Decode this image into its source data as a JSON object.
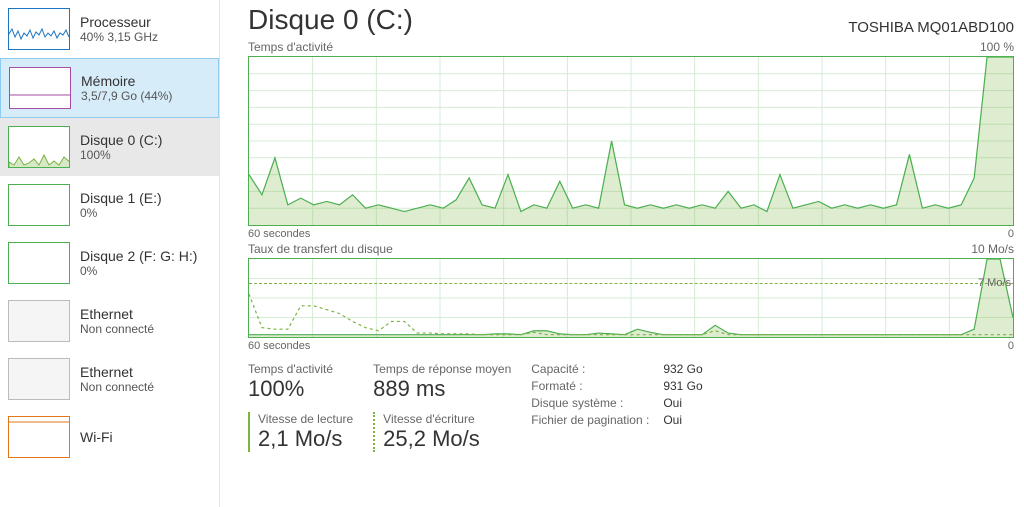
{
  "sidebar": [
    {
      "title": "Processeur",
      "sub": "40%  3,15 GHz",
      "kind": "blue"
    },
    {
      "title": "Mémoire",
      "sub": "3,5/7,9 Go (44%)",
      "kind": "purple",
      "state": "mem"
    },
    {
      "title": "Disque 0 (C:)",
      "sub": "100%",
      "kind": "green",
      "state": "dsk"
    },
    {
      "title": "Disque 1 (E:)",
      "sub": "0%",
      "kind": "green"
    },
    {
      "title": "Disque 2 (F: G: H:)",
      "sub": "0%",
      "kind": "green"
    },
    {
      "title": "Ethernet",
      "sub": "Non connecté",
      "kind": "gray"
    },
    {
      "title": "Ethernet",
      "sub": "Non connecté",
      "kind": "gray"
    },
    {
      "title": "Wi-Fi",
      "sub": "",
      "kind": "orange"
    }
  ],
  "header": {
    "title": "Disque 0 (C:)",
    "model": "TOSHIBA MQ01ABD100"
  },
  "chart_data": [
    {
      "type": "area",
      "title": "Temps d'activité",
      "ylabel": "100 %",
      "xlabel_left": "60 secondes",
      "xlabel_right": "0",
      "ylim": [
        0,
        100
      ],
      "x": [
        0,
        1,
        2,
        3,
        4,
        5,
        6,
        7,
        8,
        9,
        10,
        11,
        12,
        13,
        14,
        15,
        16,
        17,
        18,
        19,
        20,
        21,
        22,
        23,
        24,
        25,
        26,
        27,
        28,
        29,
        30,
        31,
        32,
        33,
        34,
        35,
        36,
        37,
        38,
        39,
        40,
        41,
        42,
        43,
        44,
        45,
        46,
        47,
        48,
        49,
        50,
        51,
        52,
        53,
        54,
        55,
        56,
        57,
        58,
        59
      ],
      "values": [
        30,
        18,
        40,
        12,
        16,
        12,
        14,
        12,
        18,
        10,
        12,
        10,
        8,
        10,
        12,
        10,
        15,
        28,
        12,
        10,
        30,
        8,
        12,
        10,
        26,
        10,
        12,
        10,
        50,
        12,
        10,
        12,
        10,
        12,
        10,
        12,
        10,
        20,
        10,
        12,
        8,
        30,
        10,
        12,
        14,
        10,
        12,
        10,
        12,
        10,
        12,
        42,
        10,
        12,
        10,
        12,
        28,
        100,
        100,
        100
      ]
    },
    {
      "type": "line-area",
      "title": "Taux de transfert du disque",
      "ylabel": "10 Mo/s",
      "xlabel_left": "60 secondes",
      "xlabel_right": "0",
      "ylim": [
        0,
        10
      ],
      "marker": {
        "value": 7,
        "label": "7 Mo/s"
      },
      "series": [
        {
          "name": "read",
          "style": "dashed",
          "values": [
            5.5,
            1.2,
            1.0,
            1.0,
            4.0,
            4.0,
            3.5,
            3.0,
            2.0,
            1.2,
            0.8,
            2.0,
            2.0,
            0.5,
            0.5,
            0.4,
            0.4,
            0.4,
            0.3,
            0.3,
            0.3,
            0.3,
            0.6,
            0.3,
            0.3,
            0.3,
            0.3,
            0.3,
            0.3,
            0.3,
            0.3,
            0.3,
            0.3,
            0.3,
            0.3,
            0.3,
            0.8,
            0.3,
            0.3,
            0.3,
            0.3,
            0.3,
            0.3,
            0.3,
            0.3,
            0.3,
            0.3,
            0.3,
            0.3,
            0.3,
            0.3,
            0.3,
            0.3,
            0.3,
            0.3,
            0.3,
            0.3,
            0.3,
            0.3,
            0.3
          ]
        },
        {
          "name": "write",
          "style": "solid-area",
          "values": [
            0.3,
            0.3,
            0.3,
            0.3,
            0.3,
            0.3,
            0.3,
            0.3,
            0.3,
            0.3,
            0.3,
            0.3,
            0.3,
            0.3,
            0.3,
            0.3,
            0.3,
            0.3,
            0.3,
            0.4,
            0.4,
            0.3,
            0.8,
            0.8,
            0.4,
            0.3,
            0.3,
            0.5,
            0.4,
            0.3,
            1.0,
            0.6,
            0.3,
            0.3,
            0.3,
            0.3,
            1.5,
            0.5,
            0.3,
            0.3,
            0.3,
            0.3,
            0.3,
            0.3,
            0.3,
            0.3,
            0.3,
            0.3,
            0.3,
            0.3,
            0.3,
            0.3,
            0.3,
            0.3,
            0.3,
            0.3,
            1.0,
            10,
            10,
            2.5
          ]
        }
      ]
    }
  ],
  "stats": {
    "activity_label": "Temps d'activité",
    "activity_value": "100%",
    "response_label": "Temps de réponse moyen",
    "response_value": "889 ms",
    "read_label": "Vitesse de lecture",
    "read_value": "2,1 Mo/s",
    "write_label": "Vitesse d'écriture",
    "write_value": "25,2 Mo/s"
  },
  "props": {
    "labels": [
      "Capacité :",
      "Formaté :",
      "Disque système :",
      "Fichier de pagination :"
    ],
    "values": [
      "932 Go",
      "931 Go",
      "Oui",
      "Oui"
    ]
  }
}
